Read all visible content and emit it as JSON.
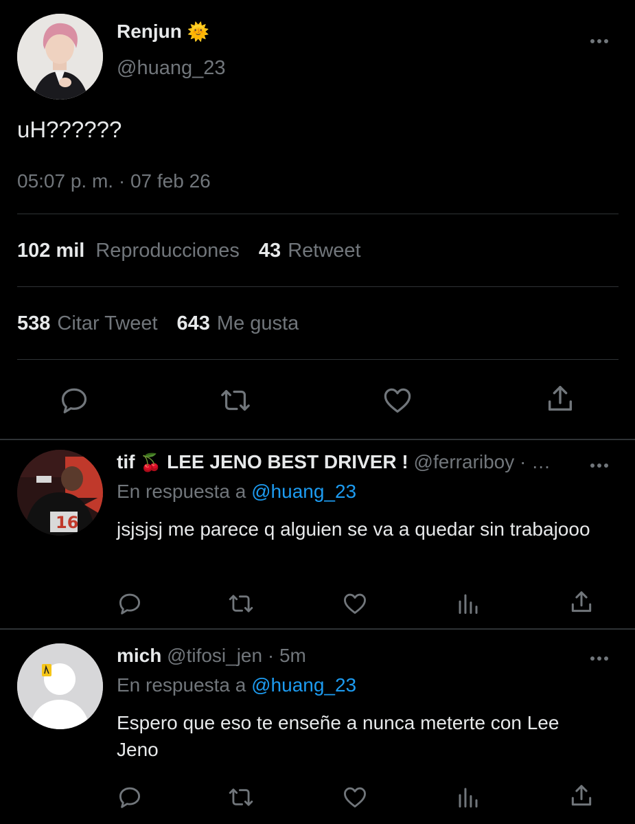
{
  "main_tweet": {
    "author_name": "Renjun",
    "name_emoji": "🌞",
    "handle": "@huang_23",
    "text": "uH??????",
    "timestamp": "05:07 p. m. · 07 feb 26",
    "views_count": "102 mil",
    "views_label": "Reproducciones",
    "retweets_count": "43",
    "retweets_label": "Retweet",
    "quotes_count": "538",
    "quotes_label": "Citar Tweet",
    "likes_count": "643",
    "likes_label": "Me gusta",
    "actions": [
      "reply-icon",
      "retweet-icon",
      "like-icon",
      "share-icon"
    ]
  },
  "replies": [
    {
      "name": "tif",
      "name_emoji": "🍒",
      "name_suffix": "LEE JENO BEST DRIVER !",
      "handle": "@ferrariboy",
      "meta": "· …",
      "reply_prefix": "En respuesta a",
      "reply_to": "@huang_23",
      "text": "jsjsjsj me parece q alguien se va a quedar sin trabajooo",
      "actions": [
        "reply-icon",
        "retweet-icon",
        "like-icon",
        "views-icon",
        "share-icon"
      ]
    },
    {
      "name": "mich",
      "handle": "@tifosi_jen",
      "meta": "· 5m",
      "reply_prefix": "En respuesta a",
      "reply_to": "@huang_23",
      "text": "Espero que eso te enseñe a nunca meterte con Lee Jeno",
      "actions": [
        "reply-icon",
        "retweet-icon",
        "like-icon",
        "views-icon",
        "share-icon"
      ]
    }
  ],
  "colors": {
    "background": "#000000",
    "text": "#e7e9ea",
    "secondary": "#71767b",
    "link": "#1d9bf0",
    "divider": "#2f3336"
  }
}
